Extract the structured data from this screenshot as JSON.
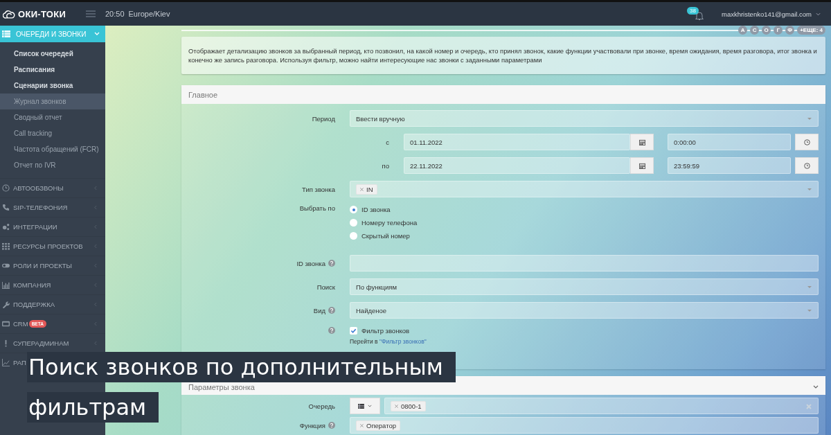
{
  "topbar": {
    "logo": "ОКИ-ТОКИ",
    "time": "20:50",
    "timezone": "Europe/Kiev",
    "notifications": "38",
    "user": "maxkhristenko141@gmail.com"
  },
  "sidebar": {
    "open_section": {
      "label": "ОЧЕРЕДИ И ЗВОНКИ",
      "expanded": true,
      "children": [
        {
          "label": "Список очередей",
          "bold": true,
          "selected": false
        },
        {
          "label": "Расписания",
          "bold": true,
          "selected": false
        },
        {
          "label": "Сценарии звонка",
          "bold": true,
          "selected": false
        },
        {
          "label": "Журнал звонков",
          "bold": false,
          "selected": true
        },
        {
          "label": "Сводный отчет",
          "bold": false,
          "selected": false
        },
        {
          "label": "Call tracking",
          "bold": false,
          "selected": false
        },
        {
          "label": "Частота обращений (FCR)",
          "bold": false,
          "selected": false
        },
        {
          "label": "Отчет по IVR",
          "bold": false,
          "selected": false
        }
      ]
    },
    "sections": [
      {
        "label": "АВТООБЗВОНЫ"
      },
      {
        "label": "SIP-ТЕЛЕФОНИЯ"
      },
      {
        "label": "ИНТЕГРАЦИИ"
      },
      {
        "label": "РЕСУРСЫ ПРОЕКТОВ"
      },
      {
        "label": "РОЛИ И ПРОЕКТЫ"
      },
      {
        "label": "КОМПАНИЯ"
      },
      {
        "label": "ПОДДЕРЖКА"
      },
      {
        "label": "CRM",
        "badge": "BETA"
      },
      {
        "label": "СУПЕРАДМИНАМ"
      },
      {
        "label": "РАП"
      }
    ]
  },
  "page_users": {
    "initials": [
      "А",
      "С",
      "О",
      "Г",
      "Ф"
    ],
    "more": "+ЕЩЕ: 4"
  },
  "info": "Отображает детализацию звонков за выбранный период, кто позвонил, на какой номер и очередь, кто принял звонок, какие функции участвовали при звонке, время ожидания, время разговора, итог звонка и конечно же запись разговора. Используя фильтр, можно найти интересующие нас звонки с заданными параметрами",
  "main_panel": {
    "title": "Главное",
    "period": {
      "label": "Период",
      "value": "Ввести вручную"
    },
    "range": [
      {
        "label": "с",
        "date": "01.11.2022",
        "time": "0:00:00"
      },
      {
        "label": "по",
        "date": "22.11.2022",
        "time": "23:59:59"
      }
    ],
    "call_type": {
      "label": "Тип звонка",
      "tags": [
        "IN"
      ]
    },
    "select_by": {
      "label": "Выбрать по",
      "options": [
        {
          "label": "ID звонка",
          "selected": true
        },
        {
          "label": "Номеру телефона",
          "selected": false
        },
        {
          "label": "Скрытый номер",
          "selected": false
        }
      ]
    },
    "call_id": {
      "label": "ID звонка"
    },
    "search": {
      "label": "Поиск",
      "value": "По функциям"
    },
    "view": {
      "label": "Вид",
      "value": "Найденое"
    },
    "filter": {
      "label": "Фильтр звонков",
      "checked": true
    },
    "filter_link": {
      "text": "Перейти в ",
      "link": "\"Фильтр звонков\""
    }
  },
  "params_panel": {
    "title": "Параметры звонка",
    "expanded": true,
    "queue": {
      "label": "Очередь",
      "tags": [
        "0800-1"
      ]
    },
    "function": {
      "label": "Функция",
      "tags": [
        "Оператор"
      ]
    }
  },
  "caption": [
    "Поиск звонков по дополнительным",
    "фильтрам"
  ]
}
